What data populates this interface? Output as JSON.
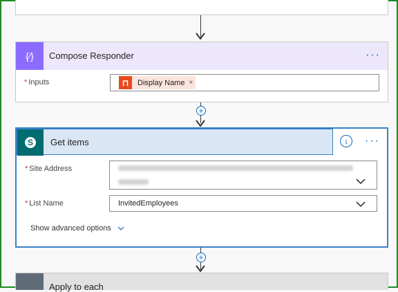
{
  "compose": {
    "title": "Compose Responder",
    "inputs_label": "Inputs",
    "token_label": "Display Name",
    "token_remove": "×",
    "more": "···"
  },
  "get_items": {
    "title": "Get items",
    "info": "i",
    "more": "···",
    "site_address_label": "Site Address",
    "list_name_label": "List Name",
    "list_name_value": "InvitedEmployees",
    "advanced": "Show advanced options"
  },
  "apply": {
    "title": "Apply to each"
  },
  "colors": {
    "compose_accent": "#8c6cff",
    "sharepoint": "#036c70",
    "selected_border": "#3a80c8",
    "frame": "#1f8a1f"
  },
  "icons": [
    "compose-icon",
    "sharepoint-icon",
    "office-icon",
    "info-icon",
    "chevron-down-icon",
    "plus-icon",
    "arrow-down-icon"
  ]
}
